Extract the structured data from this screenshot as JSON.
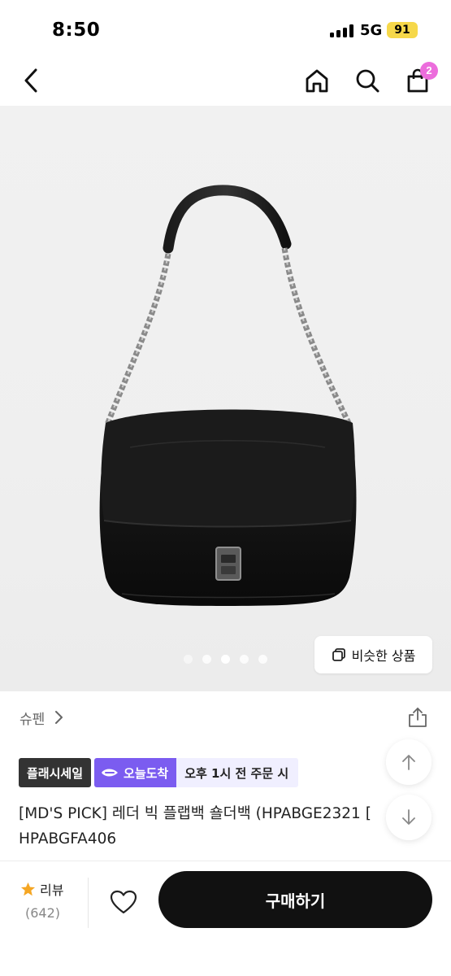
{
  "status_bar": {
    "time": "8:50",
    "network": "5G",
    "battery": "91"
  },
  "nav": {
    "back_icon": "chevron-left-icon",
    "home_icon": "home-icon",
    "search_icon": "search-icon",
    "cart_icon": "shopping-bag-icon",
    "cart_badge": "2",
    "badge_color": "#ec6ddc"
  },
  "gallery": {
    "similar_label": "비슷한 상품",
    "image_count": 5,
    "active_index": 2
  },
  "brand": {
    "name": "슈펜"
  },
  "tags": {
    "flash_sale": "플래시세일",
    "today_arrival": "오늘도착",
    "order_deadline": "오후 1시 전 주문 시",
    "today_color": "#7b5cf0"
  },
  "product": {
    "title_line1": "[MD'S PICK] 레더 빅 플랩백 숄더백 (HPABGE2321 [",
    "title_line2": "HPABGFA406"
  },
  "bottom_bar": {
    "review_label": "리뷰",
    "review_count": "(642)",
    "buy_label": "구매하기",
    "star_color": "#f5a623"
  }
}
